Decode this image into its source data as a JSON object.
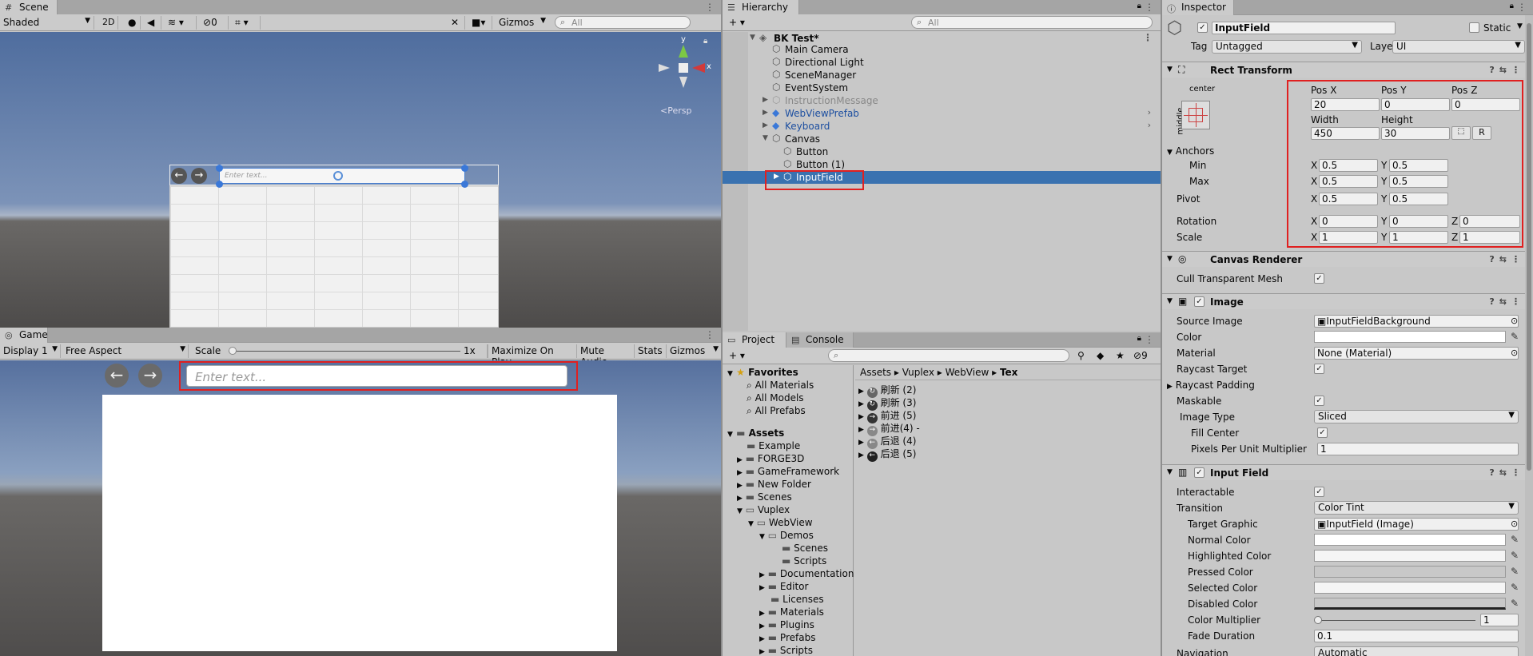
{
  "scene": {
    "tab": "Scene",
    "shading": "Shaded",
    "mode2d": "2D",
    "hidden_count": "0",
    "gizmos": "Gizmos",
    "search_placeholder": "All",
    "axis_y": "y",
    "axis_x": "x",
    "persp": "Persp",
    "input_placeholder": "Enter text..."
  },
  "game": {
    "tab": "Game",
    "display": "Display 1",
    "aspect": "Free Aspect",
    "scale_label": "Scale",
    "scale_value": "1x",
    "scale_fraction": 0.0,
    "maximize": "Maximize On Play",
    "mute": "Mute Audio",
    "stats": "Stats",
    "gizmos": "Gizmos",
    "input_placeholder": "Enter text..."
  },
  "hierarchy": {
    "tab": "Hierarchy",
    "search_placeholder": "All",
    "scene_name": "BK Test*",
    "items": [
      {
        "label": "Main Camera"
      },
      {
        "label": "Directional Light"
      },
      {
        "label": "SceneManager"
      },
      {
        "label": "EventSystem"
      },
      {
        "label": "InstructionMessage"
      },
      {
        "label": "WebViewPrefab"
      },
      {
        "label": "Keyboard"
      },
      {
        "label": "Canvas"
      },
      {
        "label": "Button"
      },
      {
        "label": "Button (1)"
      },
      {
        "label": "InputField"
      }
    ]
  },
  "project": {
    "tab": "Project",
    "console_tab": "Console",
    "hidden_count": "9",
    "breadcrumb": [
      "Assets",
      "WebView",
      "Tex"
    ],
    "vuplex": "Vuplex",
    "favorites": "Favorites",
    "fav_items": [
      "All Materials",
      "All Models",
      "All Prefabs"
    ],
    "assets": "Assets",
    "tree": [
      {
        "label": "Example"
      },
      {
        "label": "FORGE3D"
      },
      {
        "label": "GameFramework"
      },
      {
        "label": "New Folder"
      },
      {
        "label": "Scenes"
      },
      {
        "label": "Vuplex"
      },
      {
        "label": "WebView"
      },
      {
        "label": "Demos"
      },
      {
        "label": "Scenes"
      },
      {
        "label": "Scripts"
      },
      {
        "label": "Documentation"
      },
      {
        "label": "Editor"
      },
      {
        "label": "Licenses"
      },
      {
        "label": "Materials"
      },
      {
        "label": "Plugins"
      },
      {
        "label": "Prefabs"
      },
      {
        "label": "Scripts"
      }
    ],
    "files": [
      "刷新 (2)",
      "刷新 (3)",
      "前进 (5)",
      "前进(4) -",
      "后退 (4)",
      "后退 (5)"
    ]
  },
  "inspector": {
    "tab": "Inspector",
    "object_name": "InputField",
    "static": "Static",
    "tag_label": "Tag",
    "tag": "Untagged",
    "layer_label": "Layer",
    "layer": "UI",
    "rect": {
      "title": "Rect Transform",
      "center": "center",
      "middle": "middle",
      "posx_label": "Pos X",
      "posy_label": "Pos Y",
      "posz_label": "Pos Z",
      "posx": "20",
      "posy": "0",
      "posz": "0",
      "width_label": "Width",
      "height_label": "Height",
      "width": "450",
      "height": "30",
      "r_btn": "R",
      "anchors": "Anchors",
      "min": "Min",
      "max": "Max",
      "pivot": "Pivot",
      "rotation": "Rotation",
      "scale": "Scale",
      "x": "X",
      "y": "Y",
      "z": "Z",
      "min_x": "0.5",
      "min_y": "0.5",
      "max_x": "0.5",
      "max_y": "0.5",
      "pivot_x": "0.5",
      "pivot_y": "0.5",
      "rot_x": "0",
      "rot_y": "0",
      "rot_z": "0",
      "scale_x": "1",
      "scale_y": "1",
      "scale_z": "1"
    },
    "canvas_renderer": {
      "title": "Canvas Renderer",
      "cull": "Cull Transparent Mesh"
    },
    "image": {
      "title": "Image",
      "source_label": "Source Image",
      "source": "InputFieldBackground",
      "color_label": "Color",
      "material_label": "Material",
      "material": "None (Material)",
      "raycast_target": "Raycast Target",
      "raycast_padding": "Raycast Padding",
      "maskable": "Maskable",
      "image_type_label": "Image Type",
      "image_type": "Sliced",
      "fill_center": "Fill Center",
      "ppu_label": "Pixels Per Unit Multiplier",
      "ppu": "1"
    },
    "input_field": {
      "title": "Input Field",
      "interactable": "Interactable",
      "transition_label": "Transition",
      "transition": "Color Tint",
      "target_label": "Target Graphic",
      "target": "InputField (Image)",
      "normal": "Normal Color",
      "highlighted": "Highlighted Color",
      "pressed": "Pressed Color",
      "selected": "Selected Color",
      "disabled": "Disabled Color",
      "multiplier_label": "Color Multiplier",
      "multiplier": "1",
      "fade_label": "Fade Duration",
      "fade": "0.1",
      "navigation_label": "Navigation",
      "navigation": "Automatic"
    }
  },
  "colors": {
    "selection": "#3a72b0",
    "highlight": "#e02020",
    "sky": "#5a78a8",
    "ground": "#5c5a58"
  }
}
